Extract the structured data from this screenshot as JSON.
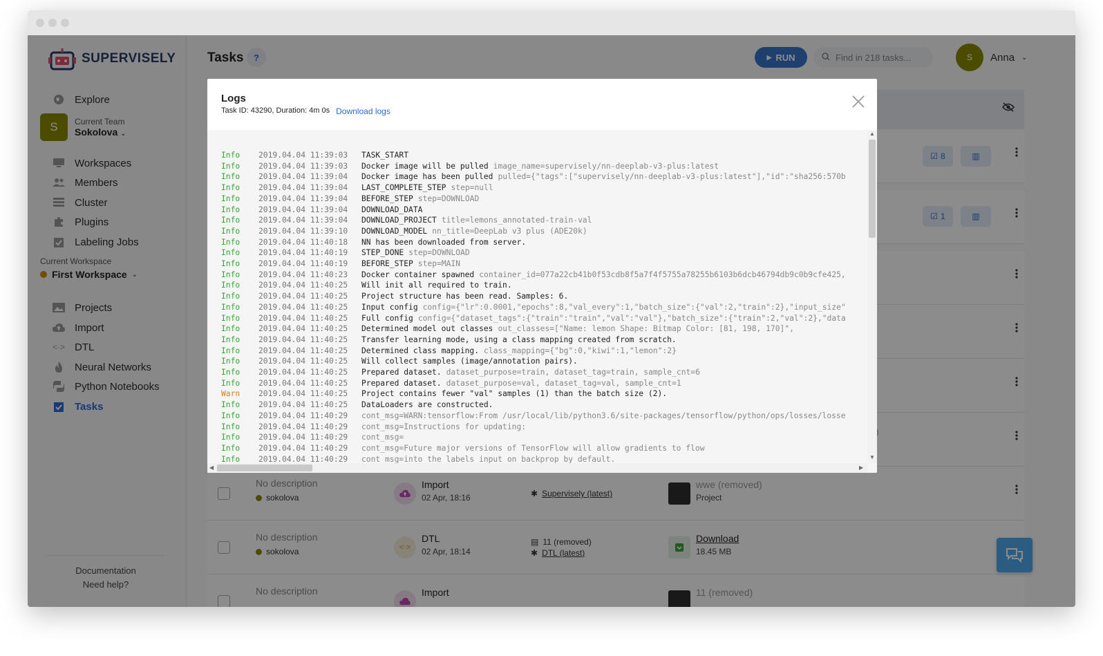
{
  "brand": {
    "name": "SUPERVISELY"
  },
  "sidebar": {
    "explore": "Explore",
    "team_label": "Current Team",
    "team_avatar": "S",
    "team_name": "Sokolova",
    "team_items": [
      {
        "label": "Workspaces",
        "icon": "monitor-icon"
      },
      {
        "label": "Members",
        "icon": "members-icon"
      },
      {
        "label": "Cluster",
        "icon": "cluster-icon"
      },
      {
        "label": "Plugins",
        "icon": "puzzle-icon"
      },
      {
        "label": "Labeling Jobs",
        "icon": "clipboard-icon"
      }
    ],
    "workspace_label": "Current Workspace",
    "workspace_name": "First Workspace",
    "workspace_items": [
      {
        "label": "Projects",
        "icon": "images-icon"
      },
      {
        "label": "Import",
        "icon": "cloud-upload-icon"
      },
      {
        "label": "DTL",
        "icon": "code-icon"
      },
      {
        "label": "Neural Networks",
        "icon": "flame-icon"
      },
      {
        "label": "Python Notebooks",
        "icon": "python-icon"
      },
      {
        "label": "Tasks",
        "icon": "tasks-icon",
        "active": true
      }
    ],
    "footer_docs": "Documentation",
    "footer_help": "Need help?"
  },
  "header": {
    "title": "Tasks",
    "help": "?",
    "run_label": "RUN",
    "search_placeholder": "Find in 218 tasks...",
    "user_avatar": "S",
    "user_name": "Anna"
  },
  "rows_side": {
    "badge1": "8",
    "badge2": "1",
    "partial_text": "d)"
  },
  "rows": [
    {
      "description": "No description",
      "owner": "sokolova",
      "type": "Import",
      "date": "02 Apr, 18:16",
      "source": "Supervisely (latest)",
      "result_title": "wwe (removed)",
      "result_sub": "Project"
    },
    {
      "description": "No description",
      "owner": "sokolova",
      "type": "DTL",
      "date": "02 Apr, 18:14",
      "source_line1": "11 (removed)",
      "source_line2": "DTL (latest)",
      "result_title": "Download",
      "result_sub": "18.45 MB"
    },
    {
      "description": "No description",
      "type": "Import",
      "result_title": "11 (removed)"
    }
  ],
  "logs": {
    "title": "Logs",
    "task_info": "Task ID: 43290, Duration: 4m 0s",
    "download_link": "Download logs",
    "entries": [
      {
        "level": "Info",
        "ts": "2019.04.04 11:39:03",
        "msg": "TASK_START",
        "extra": ""
      },
      {
        "level": "Info",
        "ts": "2019.04.04 11:39:03",
        "msg": "Docker image will be pulled",
        "extra": "image_name=supervisely/nn-deeplab-v3-plus:latest"
      },
      {
        "level": "Info",
        "ts": "2019.04.04 11:39:04",
        "msg": "Docker image has been pulled",
        "extra": "pulled={\"tags\":[\"supervisely/nn-deeplab-v3-plus:latest\"],\"id\":\"sha256:570b"
      },
      {
        "level": "Info",
        "ts": "2019.04.04 11:39:04",
        "msg": "LAST_COMPLETE_STEP",
        "extra": "step=null"
      },
      {
        "level": "Info",
        "ts": "2019.04.04 11:39:04",
        "msg": "BEFORE_STEP",
        "extra": "step=DOWNLOAD"
      },
      {
        "level": "Info",
        "ts": "2019.04.04 11:39:04",
        "msg": "DOWNLOAD_DATA",
        "extra": ""
      },
      {
        "level": "Info",
        "ts": "2019.04.04 11:39:04",
        "msg": "DOWNLOAD_PROJECT",
        "extra": "title=lemons_annotated-train-val"
      },
      {
        "level": "Info",
        "ts": "2019.04.04 11:39:10",
        "msg": "DOWNLOAD_MODEL",
        "extra": "nn_title=DeepLab v3 plus (ADE20k)"
      },
      {
        "level": "Info",
        "ts": "2019.04.04 11:40:18",
        "msg": "NN has been downloaded from server.",
        "extra": ""
      },
      {
        "level": "Info",
        "ts": "2019.04.04 11:40:19",
        "msg": "STEP_DONE",
        "extra": "step=DOWNLOAD"
      },
      {
        "level": "Info",
        "ts": "2019.04.04 11:40:19",
        "msg": "BEFORE_STEP",
        "extra": "step=MAIN"
      },
      {
        "level": "Info",
        "ts": "2019.04.04 11:40:23",
        "msg": "Docker container spawned",
        "extra": "container_id=077a22cb41b0f53cdb8f5a7f4f5755a78255b6103b6dcb46794db9c0b9cfe425,"
      },
      {
        "level": "Info",
        "ts": "2019.04.04 11:40:25",
        "msg": "Will init all required to train.",
        "extra": ""
      },
      {
        "level": "Info",
        "ts": "2019.04.04 11:40:25",
        "msg": "Project structure has been read. Samples: 6.",
        "extra": ""
      },
      {
        "level": "Info",
        "ts": "2019.04.04 11:40:25",
        "msg": "Input config",
        "extra": "config={\"lr\":0.0001,\"epochs\":8,\"val_every\":1,\"batch_size\":{\"val\":2,\"train\":2},\"input_size\""
      },
      {
        "level": "Info",
        "ts": "2019.04.04 11:40:25",
        "msg": "Full config",
        "extra": "config={\"dataset_tags\":{\"train\":\"train\",\"val\":\"val\"},\"batch_size\":{\"train\":2,\"val\":2},\"data"
      },
      {
        "level": "Info",
        "ts": "2019.04.04 11:40:25",
        "msg": "Determined model out classes",
        "extra": "out_classes=[\"Name:  lemon     Shape: Bitmap       Color: [81, 198, 170]\","
      },
      {
        "level": "Info",
        "ts": "2019.04.04 11:40:25",
        "msg": "Transfer learning mode, using a class mapping created from scratch.",
        "extra": ""
      },
      {
        "level": "Info",
        "ts": "2019.04.04 11:40:25",
        "msg": "Determined class mapping.",
        "extra": "class_mapping={\"bg\":0,\"kiwi\":1,\"lemon\":2}"
      },
      {
        "level": "Info",
        "ts": "2019.04.04 11:40:25",
        "msg": "Will collect samples (image/annotation pairs).",
        "extra": ""
      },
      {
        "level": "Info",
        "ts": "2019.04.04 11:40:25",
        "msg": "Prepared dataset.",
        "extra": "dataset_purpose=train, dataset_tag=train, sample_cnt=6"
      },
      {
        "level": "Info",
        "ts": "2019.04.04 11:40:25",
        "msg": "Prepared dataset.",
        "extra": "dataset_purpose=val, dataset_tag=val, sample_cnt=1"
      },
      {
        "level": "Warn",
        "ts": "2019.04.04 11:40:25",
        "msg": "Project contains fewer \"val\" samples (1) than the batch size (2).",
        "extra": ""
      },
      {
        "level": "Info",
        "ts": "2019.04.04 11:40:25",
        "msg": "DataLoaders are constructed.",
        "extra": ""
      },
      {
        "level": "Info",
        "ts": "2019.04.04 11:40:29",
        "msg": "",
        "extra": "cont_msg=WARN:tensorflow:From /usr/local/lib/python3.6/site-packages/tensorflow/python/ops/losses/losse"
      },
      {
        "level": "Info",
        "ts": "2019.04.04 11:40:29",
        "msg": "",
        "extra": "cont_msg=Instructions for updating:"
      },
      {
        "level": "Info",
        "ts": "2019.04.04 11:40:29",
        "msg": "",
        "extra": "cont_msg="
      },
      {
        "level": "Info",
        "ts": "2019.04.04 11:40:29",
        "msg": "",
        "extra": "cont_msg=Future major versions of TensorFlow will allow gradients to flow"
      },
      {
        "level": "Info",
        "ts": "2019.04.04 11:40:29",
        "msg": "",
        "extra": "cont_msg=into the labels input on backprop by default."
      }
    ]
  },
  "colors": {
    "accent": "#2d6ad6",
    "info": "#2ea82e",
    "warn": "#e07b1a",
    "avatar": "#8a8a00"
  }
}
